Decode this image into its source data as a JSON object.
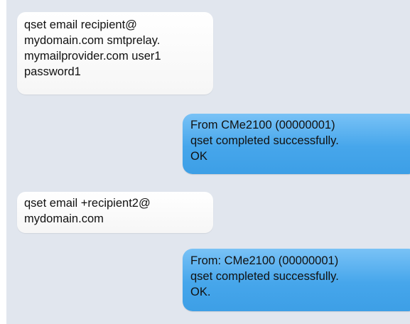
{
  "messages": [
    {
      "direction": "incoming",
      "text": "qset email recipient@\nmydomain.com smtprelay.\nmymailprovider.com user1\npassword1"
    },
    {
      "direction": "outgoing",
      "text": "From CMe2100 (00000001)\nqset completed successfully.\nOK"
    },
    {
      "direction": "incoming",
      "text": "qset email +recipient2@\nmydomain.com"
    },
    {
      "direction": "outgoing",
      "text": "From: CMe2100 (00000001)\nqset completed successfully.\nOK."
    }
  ],
  "colors": {
    "background": "#e1e6ee",
    "incoming_bubble": "#ffffff",
    "outgoing_bubble": "#4aa8ec"
  }
}
